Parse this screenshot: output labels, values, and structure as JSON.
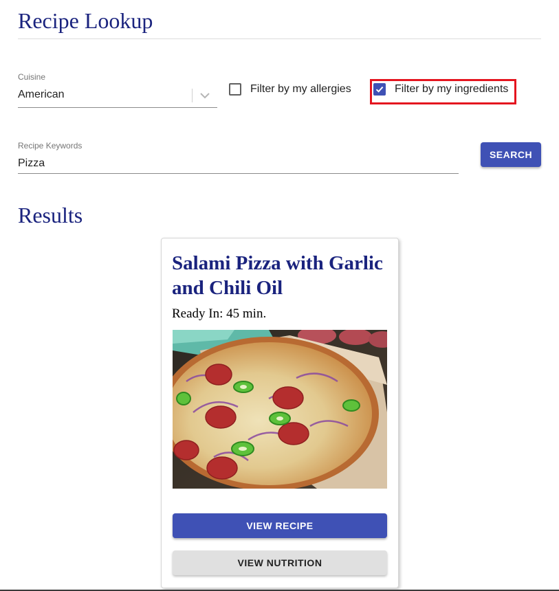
{
  "header": {
    "title": "Recipe Lookup"
  },
  "filters": {
    "cuisine": {
      "label": "Cuisine",
      "value": "American",
      "icon": "chevron-down-icon"
    },
    "allergies": {
      "label": "Filter by my allergies",
      "checked": false
    },
    "ingredients": {
      "label": "Filter by my ingredients",
      "checked": true,
      "highlight_color": "#e4151f"
    }
  },
  "search": {
    "label": "Recipe Keywords",
    "value": "Pizza",
    "button_label": "SEARCH"
  },
  "results": {
    "heading": "Results",
    "cards": [
      {
        "title": "Salami Pizza with Garlic and Chili Oil",
        "ready_in": "Ready In: 45 min.",
        "image": "pizza-photo",
        "view_recipe_label": "VIEW RECIPE",
        "view_nutrition_label": "VIEW NUTRITION"
      }
    ]
  },
  "colors": {
    "primary": "#3f51b5",
    "heading": "#1a237e",
    "secondary_button": "#e0e0e0"
  }
}
